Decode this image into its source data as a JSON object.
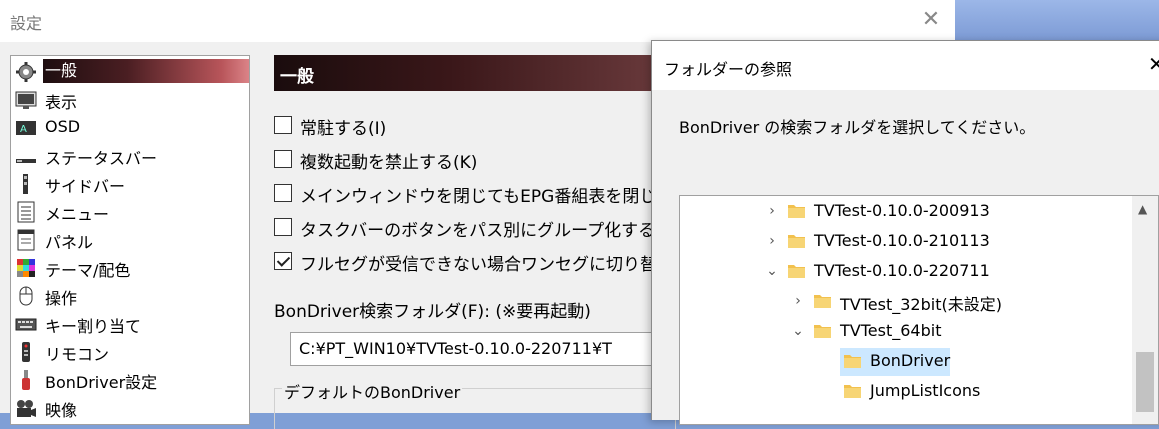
{
  "settings": {
    "title": "設定",
    "close_glyph": "✕",
    "tree_items": [
      {
        "label": "一般",
        "icon": "gear-icon",
        "selected": true
      },
      {
        "label": "表示",
        "icon": "monitor-icon"
      },
      {
        "label": "OSD",
        "icon": "osd-icon",
        "badge": "A"
      },
      {
        "label": "ステータスバー",
        "icon": "statusbar-icon"
      },
      {
        "label": "サイドバー",
        "icon": "sidebar-icon"
      },
      {
        "label": "メニュー",
        "icon": "menu-icon"
      },
      {
        "label": "パネル",
        "icon": "panel-icon"
      },
      {
        "label": "テーマ/配色",
        "icon": "palette-icon"
      },
      {
        "label": "操作",
        "icon": "mouse-icon"
      },
      {
        "label": "キー割り当て",
        "icon": "keyboard-icon"
      },
      {
        "label": "リモコン",
        "icon": "remote-icon"
      },
      {
        "label": "BonDriver設定",
        "icon": "bondriver-icon"
      },
      {
        "label": "映像",
        "icon": "video-camera-icon"
      }
    ],
    "section_title": "一般",
    "checkboxes": [
      {
        "label": "常駐する(I)",
        "checked": false
      },
      {
        "label": "複数起動を禁止する(K)",
        "checked": false
      },
      {
        "label": "メインウィンドウを閉じてもEPG番組表を閉じない(C",
        "checked": false
      },
      {
        "label": "タスクバーのボタンをパス別にグループ化する(T) (※",
        "checked": false
      },
      {
        "label": "フルセグが受信できない場合ワンセグに切り替える(",
        "checked": true
      }
    ],
    "bondriver_folder_label": "BonDriver検索フォルダ(F): (※要再起動)",
    "bondriver_folder_value": "C:¥PT_WIN10¥TVTest-0.10.0-220711¥T",
    "default_bondriver_group": "デフォルトのBonDriver"
  },
  "dialog": {
    "title": "フォルダーの参照",
    "close_glyph": "✕",
    "description": "BonDriver の検索フォルダを選択してください。",
    "folders": [
      {
        "name": "TVTest-0.10.0-200913",
        "chevron": "›",
        "level": 0
      },
      {
        "name": "TVTest-0.10.0-210113",
        "chevron": "›",
        "level": 0
      },
      {
        "name": "TVTest-0.10.0-220711",
        "chevron": "⌄",
        "level": 0
      },
      {
        "name": "TVTest_32bit(未設定)",
        "chevron": "›",
        "level": 1
      },
      {
        "name": "TVTest_64bit",
        "chevron": "⌄",
        "level": 1
      },
      {
        "name": "BonDriver",
        "chevron": "",
        "level": 2,
        "selected": true
      },
      {
        "name": "JumpListIcons",
        "chevron": "",
        "level": 2
      }
    ]
  },
  "colors": {
    "folder": "#f2c14e",
    "selection": "#cce8ff",
    "header_dark": "#1a0c0d",
    "header_light": "#e08a8e"
  }
}
